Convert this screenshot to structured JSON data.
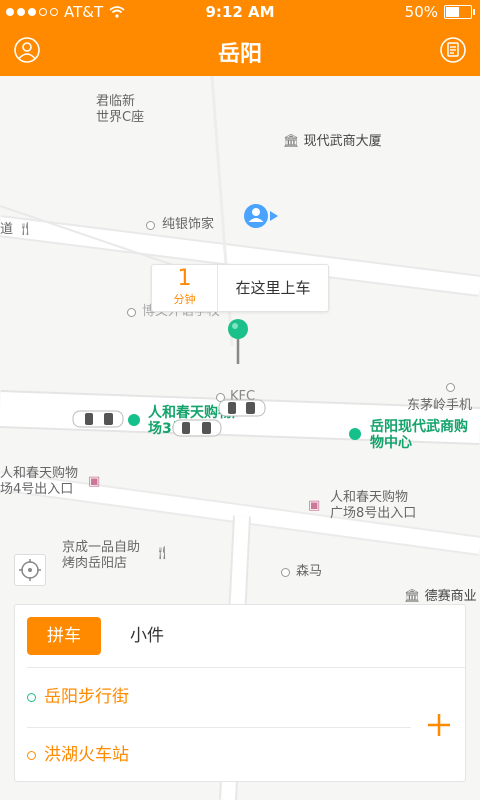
{
  "status_bar": {
    "carrier": "AT&T",
    "time": "9:12 AM",
    "battery": "50%"
  },
  "nav": {
    "title": "岳阳",
    "left_icon": "user-icon",
    "right_icon": "orders-icon"
  },
  "map": {
    "pois": {
      "junlin": "君临新\n世界C座",
      "xiandai_tower": "现代武商大厦",
      "chunyin": "纯银饰家",
      "dao": "道",
      "boya": "博文外语学校",
      "kfc": "KFC",
      "dongmaoling": "东茅岭手机",
      "renhe4": "人和春天购物\n场4号出入口",
      "renhe8": "人和春天购物\n广场8号出入口",
      "jingcheng": "京成一品自助\n烤肉岳阳店",
      "senma": "森马",
      "desai": "德赛商业"
    },
    "stations": {
      "renhe3": "人和春天购物广\n场3号门",
      "xiandai_center": "岳阳现代武商购\n物中心"
    },
    "eta": {
      "value": "1",
      "unit": "分钟",
      "message": "在这里上车"
    }
  },
  "panel": {
    "tabs": [
      "拼车",
      "小件"
    ],
    "origin": "岳阳步行街",
    "destination": "洪湖火车站"
  },
  "colors": {
    "accent": "#ff8a00",
    "station_green": "#16c08a"
  }
}
